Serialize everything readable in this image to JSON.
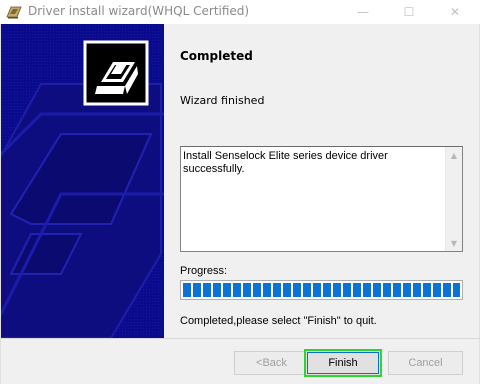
{
  "window": {
    "title": "Driver install wizard(WHQL Certified)",
    "minimize_glyph": "—",
    "maximize_glyph": "☐",
    "close_glyph": "✕"
  },
  "content": {
    "heading": "Completed",
    "subheading": "Wizard finished",
    "log_text": "Install Senselock Elite series device driver successfully.",
    "progress_label": "Progress:",
    "progress_value": 1.0,
    "final_message": "Completed,please select \"Finish\" to quit."
  },
  "buttons": {
    "back_label": "<Back",
    "finish_label": "Finish",
    "cancel_label": "Cancel"
  },
  "scrollbar": {
    "up_glyph": "▲",
    "down_glyph": "▼"
  },
  "colors": {
    "side_panel_bg": "#0a0a8c",
    "progress_fill": "#0c72d6",
    "focus_highlight": "#2ed52e"
  },
  "icons": {
    "app": "install-wizard-icon",
    "side_panel": "printer-icon"
  }
}
